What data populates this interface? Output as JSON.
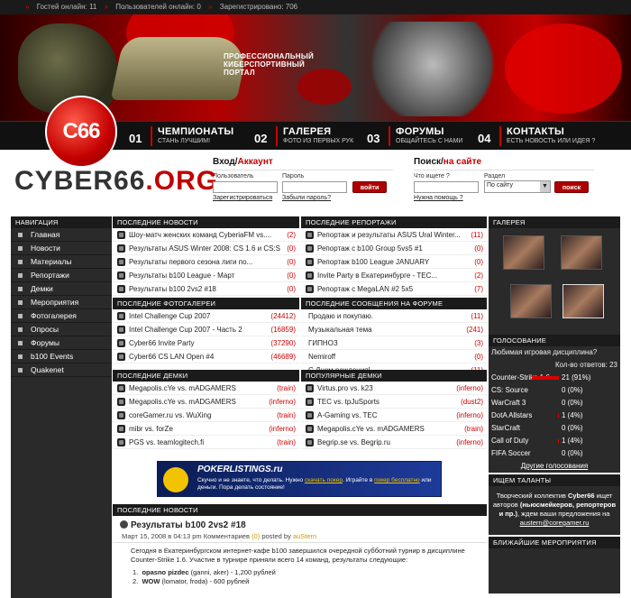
{
  "topbar": {
    "guests": "Гостей онлайн: 11",
    "users": "Пользователей онлайн: 0",
    "registered": "Зарегистрировано: 706"
  },
  "banner": {
    "tagline_1": "ПРОФЕССИОНАЛЬНЫЙ",
    "tagline_2": "КИБЕРСПОРТИВНЫЙ",
    "tagline_3": "ПОРТАЛ",
    "logo_badge": "C66"
  },
  "menu": [
    {
      "num": "01",
      "title": "ЧЕМПИОНАТЫ",
      "sub": "СТАНЬ ЛУЧШИМ!"
    },
    {
      "num": "02",
      "title": "ГАЛЕРЕЯ",
      "sub": "ФОТО ИЗ ПЕРВЫХ РУК"
    },
    {
      "num": "03",
      "title": "ФОРУМЫ",
      "sub": "ОБЩАЙТЕСЬ С НАМИ"
    },
    {
      "num": "04",
      "title": "КОНТАКТЫ",
      "sub": "ЕСТЬ НОВОСТЬ ИЛИ ИДЕЯ ?"
    }
  ],
  "logo": {
    "main": "CYBER66",
    "dot": ".",
    "org": "ORG"
  },
  "login": {
    "title": "Вход/",
    "title_red": "Аккаунт",
    "user_label": "Пользователь",
    "pass_label": "Пароль",
    "button": "войти",
    "register": "Зарегистрироваться",
    "forgot": "Забыли пароль?"
  },
  "search": {
    "title": "Поиск/",
    "title_red": "на сайте",
    "query_label": "Что ищете ?",
    "section_label": "Раздел",
    "section_value": "По сайту",
    "button": "поиск",
    "help": "Нужна помощь ?"
  },
  "leftnav": {
    "header": "НАВИГАЦИЯ",
    "items": [
      "Главная",
      "Новости",
      "Материалы",
      "Репортажи",
      "Демки",
      "Мероприятия",
      "Фотогалерея",
      "Опросы",
      "Форумы",
      "b100 Events",
      "Quakenet"
    ]
  },
  "latest_news": {
    "header": "ПОСЛЕДНИЕ НОВОСТИ",
    "rows": [
      {
        "t": "Шоу-матч женских команд CyberiaFM vs....",
        "c": "(2)"
      },
      {
        "t": "Результаты ASUS Winter 2008: CS 1.6 и CS:S",
        "c": "(0)"
      },
      {
        "t": "Результаты первого сезона лиги по...",
        "c": "(0)"
      },
      {
        "t": "Результаты b100 League - Март",
        "c": "(0)"
      },
      {
        "t": "Результаты b100 2vs2 #18",
        "c": "(0)"
      }
    ]
  },
  "latest_reports": {
    "header": "ПОСЛЕДНИЕ РЕПОРТАЖИ",
    "rows": [
      {
        "t": "Репортаж и результаты ASUS Ural Winter...",
        "c": "(11)"
      },
      {
        "t": "Репортаж с b100 Group 5vs5 #1",
        "c": "(0)"
      },
      {
        "t": "Репортаж b100 League JANUARY",
        "c": "(0)"
      },
      {
        "t": "Invite Party в Екатеринбурге - ТЕС...",
        "c": "(2)"
      },
      {
        "t": "Репортаж с MegaLAN #2 5x5",
        "c": "(7)"
      }
    ]
  },
  "latest_photos": {
    "header": "ПОСЛЕДНИЕ ФОТОГАЛЕРЕИ",
    "rows": [
      {
        "t": "Intel Challenge Cup 2007",
        "c": "(24412)"
      },
      {
        "t": "Intel Challenge Cup 2007 - Часть 2",
        "c": "(16859)"
      },
      {
        "t": "Cyber66 Invite Party",
        "c": "(37290)"
      },
      {
        "t": "Cyber66 CS LAN Open #4",
        "c": "(46689)"
      }
    ]
  },
  "forum_posts": {
    "header": "ПОСЛЕДНИЕ СООБЩЕНИЯ НА ФОРУМЕ",
    "rows": [
      {
        "t": "Продаю и покупаю.",
        "c": "(11)"
      },
      {
        "t": "Музыкальная тема",
        "c": "(241)"
      },
      {
        "t": "ГИПНОЗ",
        "c": "(3)"
      },
      {
        "t": "Nemiroff",
        "c": "(0)"
      },
      {
        "t": "С Днем рождения!",
        "c": "(11)"
      }
    ]
  },
  "latest_demos": {
    "header": "ПОСЛЕДНИЕ ДЕМКИ",
    "rows": [
      {
        "t": "Megapolis.cYe vs. mADGAMERS",
        "c": "(train)"
      },
      {
        "t": "Megapolis.cYe vs. mADGAMERS",
        "c": "(inferno)"
      },
      {
        "t": "coreGamer.ru vs. WuXing",
        "c": "(train)"
      },
      {
        "t": "mibr vs. forZe",
        "c": "(inferno)"
      },
      {
        "t": "PGS vs. teamlogitech.fi",
        "c": "(train)"
      }
    ]
  },
  "popular_demos": {
    "header": "ПОПУЛЯРНЫЕ ДЕМКИ",
    "rows": [
      {
        "t": "Virtus.pro vs. k23",
        "c": "(inferno)"
      },
      {
        "t": "TEC vs. tpJuSports",
        "c": "(dust2)"
      },
      {
        "t": "A-Gaming vs. TEC",
        "c": "(inferno)"
      },
      {
        "t": "Megapolis.cYe vs. mADGAMERS",
        "c": "(train)"
      },
      {
        "t": "Begrip.se vs. Begrip.ru",
        "c": "(inferno)"
      }
    ]
  },
  "gallery": {
    "header": "ГАЛЕРЕЯ"
  },
  "poll": {
    "header": "ГОЛОСОВАНИЕ",
    "question": "Любимая игровая дисциплина?",
    "total": "Кол-во ответов: 23",
    "items": [
      {
        "name": "Counter-Strike 1.6",
        "pct": "21 (91%)",
        "fill": 0.91
      },
      {
        "name": "CS: Source",
        "pct": "0 (0%)",
        "fill": 0
      },
      {
        "name": "WarCraft 3",
        "pct": "0 (0%)",
        "fill": 0
      },
      {
        "name": "DotA Allstars",
        "pct": "1 (4%)",
        "fill": 0.04
      },
      {
        "name": "StarCraft",
        "pct": "0 (0%)",
        "fill": 0
      },
      {
        "name": "Call of Duty",
        "pct": "1 (4%)",
        "fill": 0.04
      },
      {
        "name": "FIFA Soccer",
        "pct": "0 (0%)",
        "fill": 0
      }
    ],
    "other": "Другие голосования"
  },
  "talents": {
    "header": "ИЩЕМ ТАЛАНТЫ",
    "p1": "Творческий коллектив ",
    "brand": "Cyber66",
    "p2": " ищет авторов ",
    "bold": "(ньюсмейкеров, репортеров и пр.)",
    "p3": ", ждем ваши предложения на ",
    "email": "austern@coregamer.ru"
  },
  "events": {
    "header": "БЛИЖАЙШИЕ МЕРОПРИЯТИЯ"
  },
  "ad": {
    "title": "POKERLISTINGS.ru",
    "l1": "Скучно и не знаете, что делать. Нужно ",
    "link1": "скачать покер",
    "l2": ". Играйте в ",
    "link2": "покер бесплатно",
    "l3": " или деньги. Пора делать состояние!"
  },
  "article": {
    "header": "ПОСЛЕДНИЕ НОВОСТИ",
    "title": "Результаты b100 2vs2 #18",
    "date": "Март 15, 2008 в 04:13 pm",
    "comments_label": "Комментариев",
    "comments": "(0)",
    "posted_by": "posted by",
    "author": "auStern",
    "body": "Сегодня в Екатеринбургском интернет-кафе b100 завершился очередной субботний турнир в дисциплине Counter-Strike 1.6. Участие в турнире приняли всего 14 команд, результаты следующие:",
    "results": [
      {
        "n": "1.",
        "team": "opasno pizdec",
        "rest": " (ganni, aker) - 1,200 рублей"
      },
      {
        "n": "2.",
        "team": "WOW",
        "rest": " (lomator, froda) - 600 рублей"
      }
    ]
  },
  "colors": {
    "accent": "#c10000",
    "dark": "#1b1b1b"
  }
}
